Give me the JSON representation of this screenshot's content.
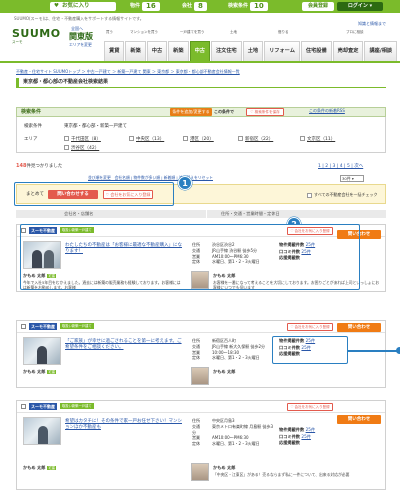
{
  "topbar": {
    "favorites": "お気に入り",
    "stats": [
      {
        "label": "物件",
        "value": "16"
      },
      {
        "label": "会社",
        "value": "8"
      },
      {
        "label": "検索条件",
        "value": "10"
      }
    ],
    "member_label": "会員登録",
    "login_label": "ログイン ▾"
  },
  "header": {
    "tagline": "SUUMO(スーモ)は、住宅・不動産購入をサポートする情報サイトです。",
    "logo": "SUUMO",
    "logo_sub": "スーモ",
    "region_small": "全国へ",
    "region": "関東版",
    "region_link": "エリアを変更",
    "links": "知識と情報まで",
    "subcats": [
      "買う",
      "マンションを買う",
      "一戸建てを買う",
      "土地",
      "借りる",
      "プロに相談"
    ]
  },
  "nav": {
    "tabs": [
      "賃貸",
      "新築",
      "中古",
      "新築",
      "中古",
      "注文住宅",
      "土地",
      "リフォーム",
      "住宅設備",
      "売却査定",
      "講座/相談"
    ],
    "active_index": 4
  },
  "breadcrumb": "不動産・住宅サイト SUUMOトップ ＞ 中古一戸建て ＞ 新築一戸建て 関東 ＞ 東京都 ＞ 東京都・都心部不動産会社情報一覧",
  "page_title": "東京都・都心部の不動産会社検索結果",
  "search_conditions": {
    "header": "検索条件",
    "change_button": "条件を追加/変更する",
    "save_label": "この条件で",
    "save_button": "♡ 検索条件を保存",
    "rss": "この条件の新着RSS",
    "rows": [
      {
        "label": "検索条件",
        "value": "東京都・都心部・新築一戸建て"
      },
      {
        "label": "エリア",
        "areas": [
          "千代田区（8）",
          "中央区（13）",
          "港区（20）",
          "新宿区（22）",
          "文京区（11）",
          "渋谷区（42）"
        ]
      }
    ]
  },
  "results": {
    "count_number": "148",
    "count_suffix": "件見つかりました",
    "pages": "1 | 2 | 3 | 4 | 5 | 次へ",
    "sort_link": "並び順を変更　会社名順 | 物件数が多い順 | 新着順 | 並び替えをリセット",
    "sort_value": "30件 ▾"
  },
  "bulk": {
    "label": "まとめて",
    "inquiry": "問い合わせする",
    "favorite": "♡ 会社をお気に入り登録",
    "all_label": "すべての不動産会社を一括チェック"
  },
  "callouts": [
    "1",
    "2"
  ],
  "columns": {
    "company": "会社名・店舗名",
    "details": "住所・交通・営業時間・定休日"
  },
  "cards": [
    {
      "brand": "スーモ不動産",
      "badge": "取扱い新築一戸建て",
      "fav": "♡ 会社をお気に入り登録",
      "inquiry": "問い合わせ",
      "catch": "わたしたちの不動産は「お客様に最適な不動産購入」になります！",
      "info": [
        {
          "k": "住所",
          "v": "渋谷区渋谷2"
        },
        {
          "k": "交通",
          "v": "JR山手線 渋谷駅 徒歩5分"
        },
        {
          "k": "営業",
          "v": "AM10:00〜PM6:30"
        },
        {
          "k": "定休",
          "v": "水曜日、第1・2・3火曜日"
        }
      ],
      "stock": [
        {
          "k": "物件掲載件数",
          "v": "25件"
        },
        {
          "k": "口コミ件数",
          "v": "25件"
        },
        {
          "k": "応援掲載数",
          "v": ""
        }
      ],
      "staff1_name": "かもめ 太郎",
      "staff1_badge": "宅建",
      "staff1_comment": "今年で入社5年目をむかえました。過去には新築の販売業務も経験しております。お客様にはは新築をお勧めします。お客様",
      "staff2_name": "かもめ 太郎",
      "staff2_comment": "お客様を一番になって考えることを大切にしております。お困りごとがあれば上司といっしょにお客様にいつでも伺います"
    },
    {
      "brand": "スーモ不動産",
      "badge": "取扱い新築一戸建て",
      "fav": "♡ 会社をお気に入り登録",
      "inquiry": "問い合わせ",
      "catch": "「ご家族」が幸せに過ごされることを第一に考えます。ご希望条件をご相談ください。",
      "info": [
        {
          "k": "住所",
          "v": "新宿区百人町"
        },
        {
          "k": "交通",
          "v": "JR山手線 新大久保駅 徒歩2分"
        },
        {
          "k": "営業",
          "v": "10:00〜18:30"
        },
        {
          "k": "定休",
          "v": "水曜日、第1・2・3火曜日"
        }
      ],
      "stock": [
        {
          "k": "物件掲載件数",
          "v": "25件"
        },
        {
          "k": "口コミ件数",
          "v": "25件"
        },
        {
          "k": "応援掲載数",
          "v": ""
        }
      ],
      "staff1_name": "かもめ 太郎",
      "staff1_badge": "宅建",
      "staff1_comment": "",
      "staff2_name": "かもめ 太郎",
      "staff2_comment": ""
    },
    {
      "brand": "スーモ不動産",
      "badge": "取扱い新築一戸建て",
      "fav": "♡ 会社をお気に入り登録",
      "inquiry": "問い合わせ",
      "catch": "希望はカタチに！その条件で家一戸お任せ下さい！マンションほか不動産も",
      "info": [
        {
          "k": "住所",
          "v": "中央区月島3"
        },
        {
          "k": "交通",
          "v": "東京メトロ有楽町線 月島駅 徒歩3分"
        },
        {
          "k": "営業",
          "v": "AM10:00〜PM6:30"
        },
        {
          "k": "定休",
          "v": "水曜日、第1・2・3火曜日"
        }
      ],
      "stock": [
        {
          "k": "物件掲載件数",
          "v": "25件"
        },
        {
          "k": "口コミ件数",
          "v": "25件"
        },
        {
          "k": "応援掲載数",
          "v": ""
        }
      ],
      "staff1_name": "かもめ 太郎",
      "staff1_badge": "宅建",
      "staff1_comment": "",
      "staff2_name": "かもめ 太郎",
      "staff2_comment": "「中央区・江東区」がある！売るならまず私に一件について、出来る対応が必要"
    }
  ]
}
